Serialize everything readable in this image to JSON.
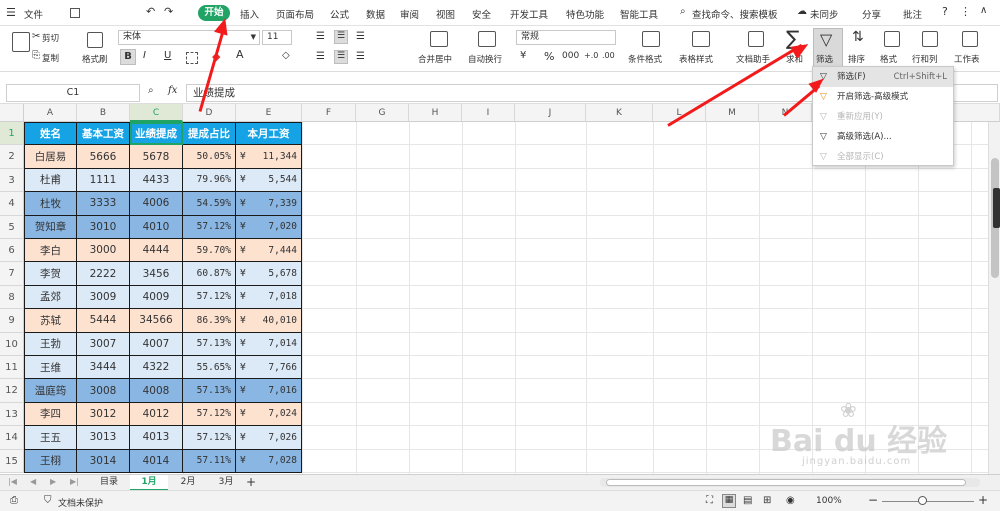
{
  "menu": {
    "file": "文件",
    "tabs": [
      "开始",
      "插入",
      "页面布局",
      "公式",
      "数据",
      "审阅",
      "视图",
      "安全",
      "开发工具",
      "特色功能",
      "智能工具"
    ],
    "search": "查找命令、搜索模板",
    "sync": "未同步",
    "share": "分享",
    "comment": "批注"
  },
  "ribbon": {
    "cut": "剪切",
    "copy": "复制",
    "format_painter": "格式刷",
    "font_name": "宋体",
    "font_size": "11",
    "bold": "B",
    "italic": "I",
    "underline": "U",
    "merge_center": "合并居中",
    "auto_wrap": "自动换行",
    "number_format": "常规",
    "percent": "%",
    "cond_format": "条件格式",
    "table_style": "表格样式",
    "doc_helper": "文档助手",
    "sum": "求和",
    "filter": "筛选",
    "sort": "排序",
    "format": "格式",
    "row_col": "行和列",
    "worksheet": "工作表"
  },
  "formula_bar": {
    "name_box": "C1",
    "fx": "fx",
    "value": "业绩提成"
  },
  "columns": [
    "A",
    "B",
    "C",
    "D",
    "E",
    "F",
    "G",
    "H",
    "I",
    "J",
    "K",
    "L",
    "M",
    "N"
  ],
  "table": {
    "headers": [
      "姓名",
      "基本工资",
      "业绩提成",
      "提成占比",
      "本月工资"
    ],
    "rows": [
      {
        "num": "1"
      },
      {
        "num": "2",
        "name": "白居易",
        "base": "5666",
        "bonus": "5678",
        "ratio": "50.05%",
        "pay": "11,344"
      },
      {
        "num": "3",
        "name": "杜甫",
        "base": "1111",
        "bonus": "4433",
        "ratio": "79.96%",
        "pay": "5,544"
      },
      {
        "num": "4",
        "name": "杜牧",
        "base": "3333",
        "bonus": "4006",
        "ratio": "54.59%",
        "pay": "7,339"
      },
      {
        "num": "5",
        "name": "贺知章",
        "base": "3010",
        "bonus": "4010",
        "ratio": "57.12%",
        "pay": "7,020"
      },
      {
        "num": "6",
        "name": "李白",
        "base": "3000",
        "bonus": "4444",
        "ratio": "59.70%",
        "pay": "7,444"
      },
      {
        "num": "7",
        "name": "李贺",
        "base": "2222",
        "bonus": "3456",
        "ratio": "60.87%",
        "pay": "5,678"
      },
      {
        "num": "8",
        "name": "孟郊",
        "base": "3009",
        "bonus": "4009",
        "ratio": "57.12%",
        "pay": "7,018"
      },
      {
        "num": "9",
        "name": "苏轼",
        "base": "5444",
        "bonus": "34566",
        "ratio": "86.39%",
        "pay": "40,010"
      },
      {
        "num": "10",
        "name": "王勃",
        "base": "3007",
        "bonus": "4007",
        "ratio": "57.13%",
        "pay": "7,014"
      },
      {
        "num": "11",
        "name": "王维",
        "base": "3444",
        "bonus": "4322",
        "ratio": "55.65%",
        "pay": "7,766"
      },
      {
        "num": "12",
        "name": "温庭筠",
        "base": "3008",
        "bonus": "4008",
        "ratio": "57.13%",
        "pay": "7,016"
      },
      {
        "num": "13",
        "name": "李四",
        "base": "3012",
        "bonus": "4012",
        "ratio": "57.12%",
        "pay": "7,024"
      },
      {
        "num": "14",
        "name": "王五",
        "base": "3013",
        "bonus": "4013",
        "ratio": "57.12%",
        "pay": "7,026"
      },
      {
        "num": "15",
        "name": "王栩",
        "base": "3014",
        "bonus": "4014",
        "ratio": "57.11%",
        "pay": "7,028"
      }
    ],
    "currency": "¥"
  },
  "filter_menu": [
    {
      "label": "筛选(F)",
      "shortcut": "Ctrl+Shift+L",
      "enabled": true
    },
    {
      "label": "开启筛选-高级模式",
      "shortcut": "",
      "enabled": true
    },
    {
      "label": "重新应用(Y)",
      "shortcut": "",
      "enabled": false
    },
    {
      "label": "高级筛选(A)...",
      "shortcut": "",
      "enabled": true
    },
    {
      "label": "全部显示(C)",
      "shortcut": "",
      "enabled": false
    }
  ],
  "sheet_tabs": [
    "目录",
    "1月",
    "2月",
    "3月"
  ],
  "active_sheet": "1月",
  "status": {
    "protect": "文档未保护",
    "zoom": "100%"
  },
  "watermark": {
    "brand": "Bai du 经验",
    "url": "jingyan.baidu.com"
  },
  "colors": {
    "header_blue": "#16a3e6",
    "row_peach": "#fde2d0",
    "row_lightblue": "#dce9f7",
    "row_blue": "#8ab6e3",
    "accent_green": "#21a366",
    "arrow_red": "#f21a1a"
  }
}
